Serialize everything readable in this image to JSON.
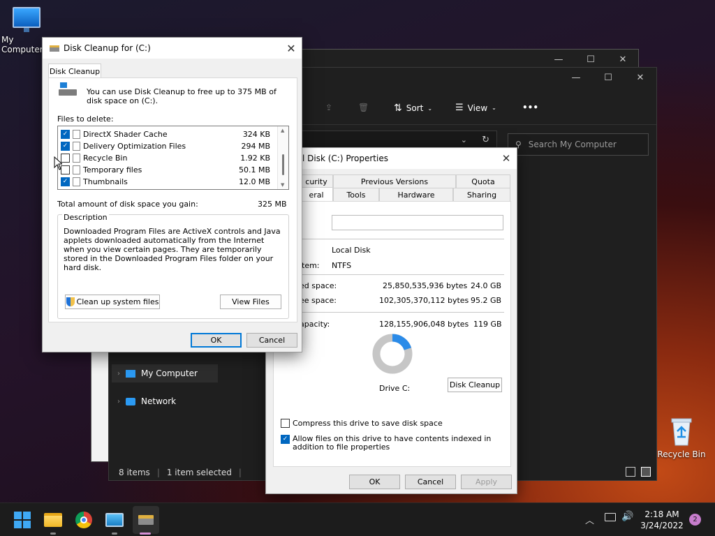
{
  "desktop": {
    "my_computer_label": "My Computer",
    "recycle_bin_label": "Recycle Bin"
  },
  "explorer": {
    "toolbar": {
      "sort_label": "Sort",
      "view_label": "View",
      "more_label": "•••"
    },
    "search_placeholder": "Search My Computer",
    "nav": [
      "My Computer",
      "Network"
    ],
    "status": {
      "items": "8 items",
      "selected": "1 item selected"
    }
  },
  "disk_cleanup": {
    "title": "Disk Cleanup for  (C:)",
    "tab": "Disk Cleanup",
    "intro": "You can use Disk Cleanup to free up to 375 MB of disk space on  (C:).",
    "files_to_delete_label": "Files to delete:",
    "files": [
      {
        "name": "DirectX Shader Cache",
        "size": "324 KB",
        "checked": true
      },
      {
        "name": "Delivery Optimization Files",
        "size": "294 MB",
        "checked": true
      },
      {
        "name": "Recycle Bin",
        "size": "1.92 KB",
        "checked": false
      },
      {
        "name": "Temporary files",
        "size": "50.1 MB",
        "checked": false
      },
      {
        "name": "Thumbnails",
        "size": "12.0 MB",
        "checked": true
      }
    ],
    "total_label": "Total amount of disk space you gain:",
    "total_value": "325 MB",
    "description_label": "Description",
    "description_text": "Downloaded Program Files are ActiveX controls and Java applets downloaded automatically from the Internet when you view certain pages. They are temporarily stored in the Downloaded Program Files folder on your hard disk.",
    "cleanup_system_button": "Clean up system files",
    "view_files_button": "View Files",
    "ok_button": "OK",
    "cancel_button": "Cancel"
  },
  "properties": {
    "title": "l Disk (C:) Properties",
    "tabs_top": [
      "curity",
      "Previous Versions",
      "Quota"
    ],
    "tabs_bottom": [
      "eral",
      "Tools",
      "Hardware",
      "Sharing"
    ],
    "type_value": "Local Disk",
    "fs_label": "tem:",
    "fs_value": "NTFS",
    "used_label": "ed space:",
    "used_bytes": "25,850,535,936 bytes",
    "used_gb": "24.0 GB",
    "free_label": "ee space:",
    "free_bytes": "102,305,370,112 bytes",
    "free_gb": "95.2 GB",
    "capacity_label": "apacity:",
    "capacity_bytes": "128,155,906,048 bytes",
    "capacity_gb": "119 GB",
    "used_fraction": 0.2,
    "drive_label": "Drive C:",
    "disk_cleanup_button": "Disk Cleanup",
    "compress_label": "Compress this drive to save disk space",
    "compress_checked": false,
    "index_label": "Allow files on this drive to have contents indexed in addition to file properties",
    "index_checked": true,
    "ok_button": "OK",
    "cancel_button": "Cancel",
    "apply_button": "Apply"
  },
  "taskbar": {
    "time": "2:18 AM",
    "date": "3/24/2022",
    "notification_count": "2"
  },
  "colors": {
    "accent": "#0067c0",
    "used_space": "#2b8be8",
    "free_space": "#c6c6c6"
  }
}
